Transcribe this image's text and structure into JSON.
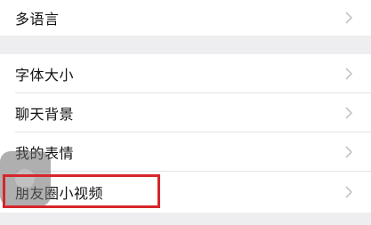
{
  "settings": {
    "group1": [
      {
        "label": "多语言"
      }
    ],
    "group2": [
      {
        "label": "字体大小"
      },
      {
        "label": "聊天背景"
      },
      {
        "label": "我的表情"
      },
      {
        "label": "朋友圈小视频"
      }
    ]
  },
  "icons": {
    "chevron": "chevron-right-icon",
    "floating": "assistive-touch-icon"
  },
  "colors": {
    "highlight": "#d6262b",
    "background": "#eeeef0",
    "cell": "#ffffff"
  }
}
